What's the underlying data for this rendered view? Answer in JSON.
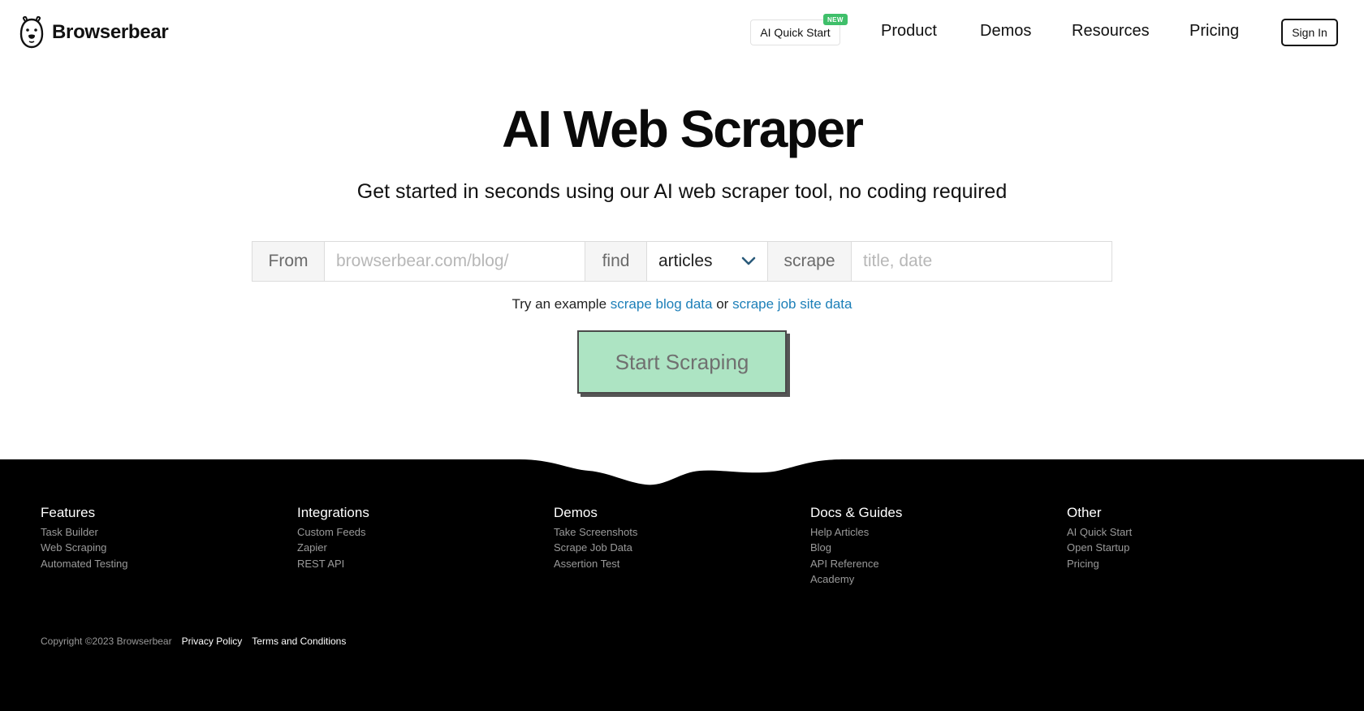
{
  "brand": {
    "name": "Browserbear",
    "logo_icon": "bear-icon"
  },
  "nav": {
    "ai_quick_start": "AI Quick Start",
    "new_badge": "NEW",
    "items": [
      "Product",
      "Demos",
      "Resources",
      "Pricing"
    ],
    "sign_in": "Sign In"
  },
  "hero": {
    "title": "AI Web Scraper",
    "subtitle": "Get started in seconds using our AI web scraper tool, no coding required"
  },
  "form": {
    "from_label": "From",
    "url_placeholder": "browserbear.com/blog/",
    "find_label": "find",
    "find_value": "articles",
    "scrape_label": "scrape",
    "fields_placeholder": "title, date"
  },
  "examples": {
    "prefix": "Try an example",
    "link1": "scrape blog data",
    "joiner": "or",
    "link2": "scrape job site data"
  },
  "cta": {
    "label": "Start Scraping"
  },
  "footer": {
    "columns": [
      {
        "heading": "Features",
        "links": [
          "Task Builder",
          "Web Scraping",
          "Automated Testing"
        ]
      },
      {
        "heading": "Integrations",
        "links": [
          "Custom Feeds",
          "Zapier",
          "REST API"
        ]
      },
      {
        "heading": "Demos",
        "links": [
          "Take Screenshots",
          "Scrape Job Data",
          "Assertion Test"
        ]
      },
      {
        "heading": "Docs & Guides",
        "links": [
          "Help Articles",
          "Blog",
          "API Reference",
          "Academy"
        ]
      },
      {
        "heading": "Other",
        "links": [
          "AI Quick Start",
          "Open Startup",
          "Pricing"
        ]
      }
    ],
    "copyright": "Copyright ©2023 Browserbear",
    "privacy": "Privacy Policy",
    "terms": "Terms and Conditions"
  },
  "colors": {
    "cta_bg": "#ade4c3",
    "link": "#1c7fb8",
    "badge": "#3fbf6a",
    "footer_bg": "#000000"
  }
}
